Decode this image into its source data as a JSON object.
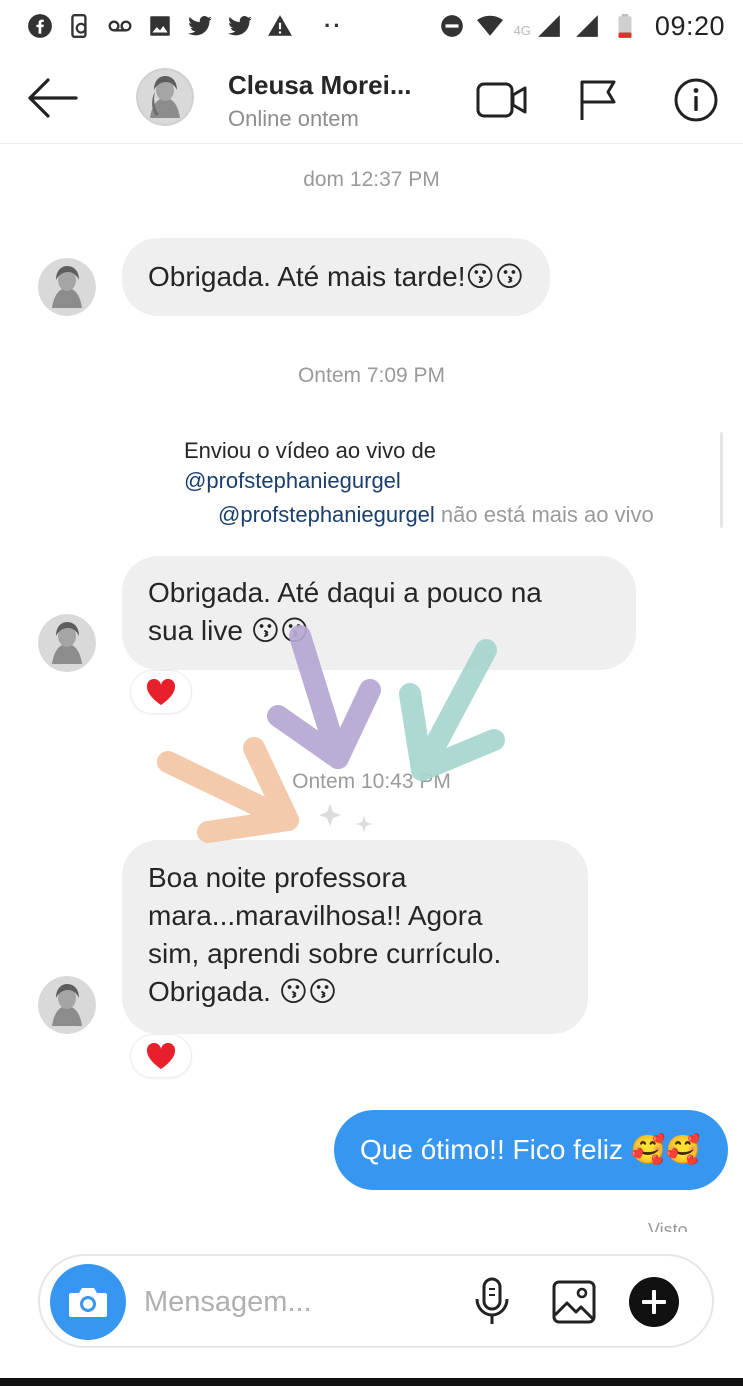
{
  "status_bar": {
    "time": "09:20",
    "network": "4G",
    "icons": [
      "facebook-icon",
      "phone-sync-icon",
      "voicemail-icon",
      "gallery-icon",
      "twitter-icon",
      "twitter-icon",
      "alert-icon",
      "more-dots-icon",
      "do-not-disturb-icon",
      "wifi-icon",
      "signal-icon",
      "signal-icon",
      "battery-icon"
    ],
    "dots": "··"
  },
  "header": {
    "name": "Cleusa Morei...",
    "status": "Online ontem",
    "icons": [
      "back-arrow-icon",
      "video-call-icon",
      "flag-icon",
      "info-icon"
    ]
  },
  "thread": {
    "ts1": "dom 12:37 PM",
    "msg1": "Obrigada. Até mais tarde!😗😗",
    "ts2": "Ontem 7:09 PM",
    "shared_intro": "Enviou o vídeo ao vivo de",
    "shared_handle_1": "@profstephaniegurgel",
    "shared_handle_2": "@profstephaniegurgel",
    "shared_status": " não está mais ao vivo",
    "msg2_line1": "Obrigada. Até daqui a pouco na",
    "msg2_line2": "sua live 😗😗",
    "ts3": "Ontem 10:43 PM",
    "msg3_line1": "Boa noite professora",
    "msg3_line2": "mara...maravilhosa!! Agora",
    "msg3_line3": "sim, aprendi sobre currículo.",
    "msg3_line4": "Obrigada.  😗😗",
    "reaction": "heart-icon",
    "out_msg": "Que ótimo!! Fico feliz 🥰🥰",
    "seen": "Visto"
  },
  "composer": {
    "placeholder": "Mensagem...",
    "icons": [
      "camera-icon",
      "microphone-icon",
      "image-icon",
      "plus-icon"
    ]
  },
  "colors": {
    "accent": "#3797f0",
    "bubble_in": "#efefef",
    "heart": "#ed4956",
    "arrow_orange": "#f3c6a4",
    "arrow_purple": "#b5a8d4",
    "arrow_teal": "#a7d6cf"
  }
}
